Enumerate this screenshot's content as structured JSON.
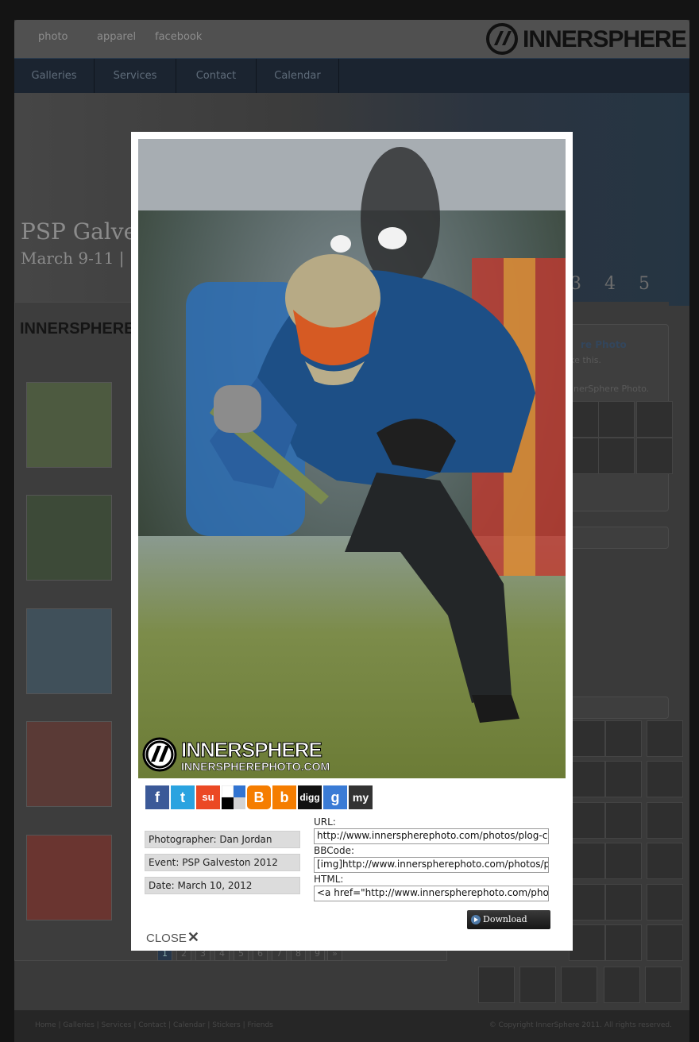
{
  "topnav": [
    "photo",
    "apparel",
    "facebook"
  ],
  "brand": {
    "logo_light": "INNER",
    "logo_bold": "SPHERE"
  },
  "mainnav": [
    "Galleries",
    "Services",
    "Contact",
    "Calendar"
  ],
  "banner": {
    "title": "PSP Galve",
    "subtitle": "March 9-11 |",
    "numbers": [
      "3",
      "4",
      "5"
    ]
  },
  "sidebar": {
    "facebook_title": "re Photo",
    "likes_text": "like this.",
    "page_text": "nnerSphere Photo."
  },
  "pagination": [
    "1",
    "2",
    "3",
    "4",
    "5",
    "6",
    "7",
    "8",
    "9",
    "»"
  ],
  "footer": {
    "links": "Home | Galleries | Services | Contact | Calendar | Stickers | Friends",
    "copyright": "© Copyright InnerSphere 2011. All rights reserved."
  },
  "lightbox": {
    "watermark": {
      "name": "INNERSPHERE",
      "url": "INNERSPHEREPHOTO.COM"
    },
    "share_icons": [
      {
        "name": "facebook-icon",
        "glyph": "f",
        "color": "#3b5998"
      },
      {
        "name": "twitter-icon",
        "glyph": "t",
        "color": "#2aa3e0"
      },
      {
        "name": "stumbleupon-icon",
        "glyph": "su",
        "color": "#eb4924"
      },
      {
        "name": "delicious-icon",
        "glyph": "",
        "color": "#ffffff"
      },
      {
        "name": "blogger-icon",
        "glyph": "B",
        "color": "#f57d00"
      },
      {
        "name": "buzz-icon",
        "glyph": "b",
        "color": "#f57d00"
      },
      {
        "name": "digg-icon",
        "glyph": "digg",
        "color": "#111111"
      },
      {
        "name": "google-icon",
        "glyph": "g",
        "color": "#3a7bd5"
      },
      {
        "name": "myspace-icon",
        "glyph": "my",
        "color": "#333333"
      }
    ],
    "photographer": "Photographer: Dan Jordan",
    "event": "Event: PSP Galveston 2012",
    "date": "Date: March 10, 2012",
    "url_label": "URL:",
    "url_value": "http://www.innerspherephoto.com/photos/plog-conten",
    "bbcode_label": "BBCode:",
    "bbcode_value": "[img]http://www.innerspherephoto.com/photos/plog-co",
    "html_label": "HTML:",
    "html_value": "<a href=\"http://www.innerspherephoto.com/photos/plo",
    "download_label": "Download Photo",
    "close_label": "CLOSE"
  }
}
